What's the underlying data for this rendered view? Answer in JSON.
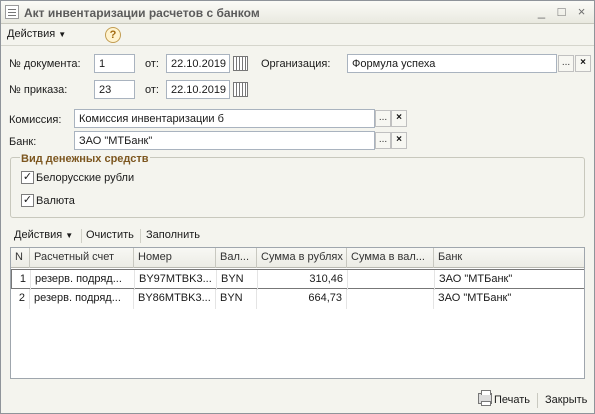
{
  "window": {
    "title": "Акт инвентаризации расчетов с банком",
    "controls": [
      "minimize-icon",
      "maximize-icon",
      "close-icon"
    ]
  },
  "commandbar": {
    "actions": "Действия",
    "help": "?"
  },
  "form": {
    "doc_number_label": "№ документа:",
    "doc_number": "1",
    "from_label": "от:",
    "doc_date": "22.10.2019",
    "organization_label": "Организация:",
    "organization": "Формула успеха",
    "order_number_label": "№ приказа:",
    "order_number": "23",
    "order_date": "22.10.2019",
    "commission_label": "Комиссия:",
    "commission": "Комиссия инвентаризации б",
    "bank_label": "Банк:",
    "bank": "ЗАО \"МТБанк\"",
    "ellipsis": "...",
    "clear": "×"
  },
  "cash_group": {
    "title": "Вид денежных средств",
    "options": [
      {
        "label": "Белорусские рубли",
        "checked": true
      },
      {
        "label": "Валюта",
        "checked": true
      }
    ]
  },
  "table_toolbar": {
    "actions": "Действия",
    "clear": "Очистить",
    "fill": "Заполнить"
  },
  "table": {
    "columns": [
      "N",
      "Расчетный счет",
      "Номер",
      "Вал...",
      "Сумма в рублях",
      "Сумма в вал...",
      "Банк"
    ],
    "rows": [
      [
        "1",
        "резерв. подряд...",
        "BY97MTBK3...",
        "BYN",
        "310,46",
        "",
        "ЗАО \"МТБанк\""
      ],
      [
        "2",
        "резерв. подряд...",
        "BY86MTBK3...",
        "BYN",
        "664,73",
        "",
        "ЗАО \"МТБанк\""
      ]
    ]
  },
  "footer": {
    "print": "Печать",
    "close": "Закрыть"
  },
  "colors": {
    "window_bg": "#f4f4ee",
    "group_title": "#7d5720",
    "field_border": "#a9b3bf"
  }
}
